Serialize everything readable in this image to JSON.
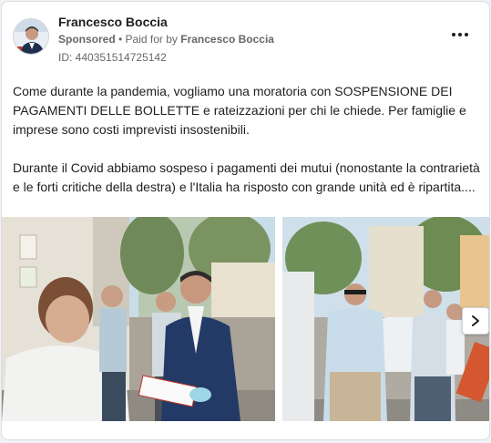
{
  "post": {
    "page_name": "Francesco Boccia",
    "sponsored_label": "Sponsored",
    "separator": " • ",
    "paid_for_prefix": "Paid for by ",
    "paid_for_name": "Francesco Boccia",
    "ad_id": "ID: 440351514725142",
    "paragraphs": [
      "Come durante la pandemia, vogliamo una moratoria con SOSPENSIONE DEI PAGAMENTI DELLE BOLLETTE e rateizzazioni per chi le chiede. Per famiglie e imprese sono costi imprevisti insostenibili.",
      "Durante il Covid abbiamo sospeso i pagamenti dei mutui (nonostante la contrarietà e le forti critiche della destra) e l'Italia ha risposto con grande unità ed è ripartita...."
    ]
  },
  "icons": {
    "more": "more-options-icon",
    "next": "chevron-right-icon"
  },
  "colors": {
    "text": "#1c1e21",
    "secondary_text": "#65676b",
    "card_border": "#dadde1"
  }
}
